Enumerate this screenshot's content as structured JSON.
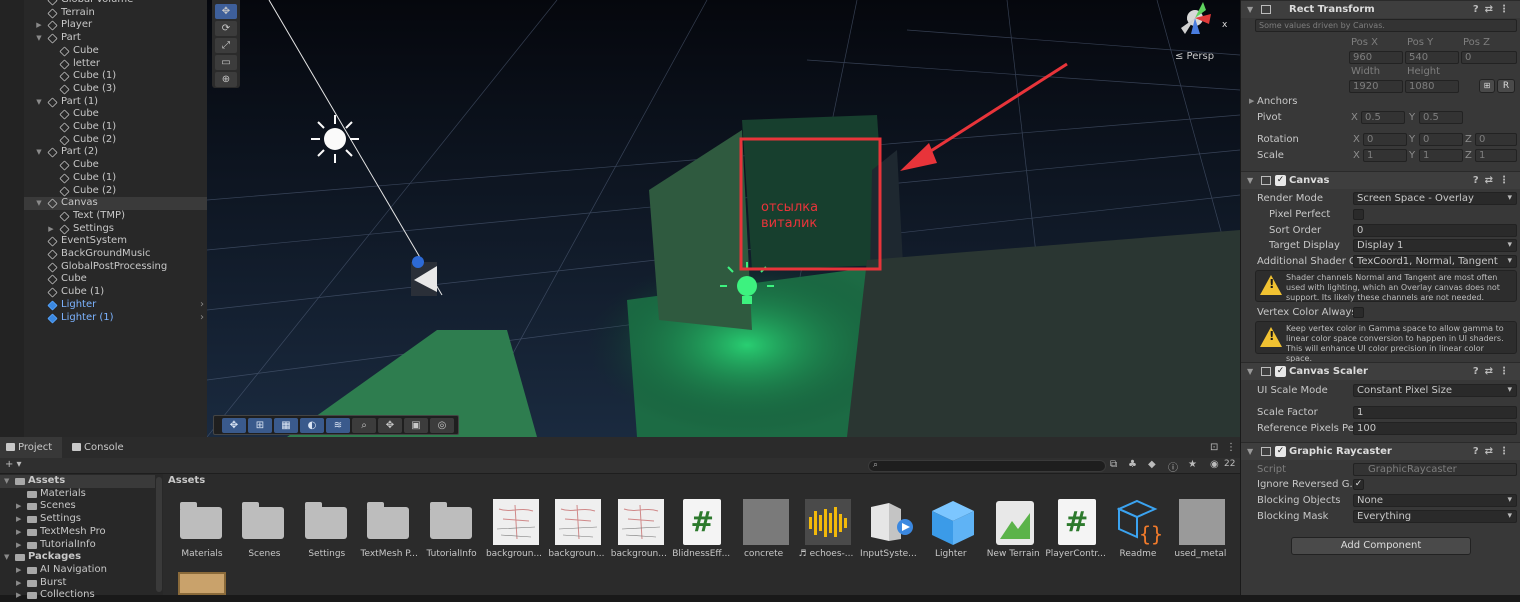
{
  "hierarchy": {
    "items": [
      {
        "label": "Global Volume",
        "indent": 2,
        "arrow": ""
      },
      {
        "label": "Terrain",
        "indent": 2,
        "arrow": ""
      },
      {
        "label": "Player",
        "indent": 2,
        "arrow": "▶"
      },
      {
        "label": "Part",
        "indent": 2,
        "arrow": "▼"
      },
      {
        "label": "Cube",
        "indent": 3,
        "arrow": ""
      },
      {
        "label": "letter",
        "indent": 3,
        "arrow": ""
      },
      {
        "label": "Cube (1)",
        "indent": 3,
        "arrow": ""
      },
      {
        "label": "Cube (3)",
        "indent": 3,
        "arrow": ""
      },
      {
        "label": "Part (1)",
        "indent": 2,
        "arrow": "▼"
      },
      {
        "label": "Cube",
        "indent": 3,
        "arrow": ""
      },
      {
        "label": "Cube (1)",
        "indent": 3,
        "arrow": ""
      },
      {
        "label": "Cube (2)",
        "indent": 3,
        "arrow": ""
      },
      {
        "label": "Part (2)",
        "indent": 2,
        "arrow": "▼"
      },
      {
        "label": "Cube",
        "indent": 3,
        "arrow": ""
      },
      {
        "label": "Cube (1)",
        "indent": 3,
        "arrow": ""
      },
      {
        "label": "Cube (2)",
        "indent": 3,
        "arrow": ""
      },
      {
        "label": "Canvas",
        "indent": 2,
        "arrow": "▼",
        "selected": true
      },
      {
        "label": "Text (TMP)",
        "indent": 3,
        "arrow": ""
      },
      {
        "label": "Settings",
        "indent": 3,
        "arrow": "▶"
      },
      {
        "label": "EventSystem",
        "indent": 2,
        "arrow": ""
      },
      {
        "label": "BackGroundMusic",
        "indent": 2,
        "arrow": ""
      },
      {
        "label": "GlobalPostProcessing",
        "indent": 2,
        "arrow": ""
      },
      {
        "label": "Cube",
        "indent": 2,
        "arrow": ""
      },
      {
        "label": "Cube (1)",
        "indent": 2,
        "arrow": ""
      },
      {
        "label": "Lighter",
        "indent": 2,
        "arrow": "",
        "prefab": true
      },
      {
        "label": "Lighter (1)",
        "indent": 2,
        "arrow": "",
        "prefab": true
      }
    ]
  },
  "scene": {
    "persp_label": "≤ Persp",
    "gizmo_axis": "x",
    "annotation_text": "отсылка\nвиталик",
    "tools": [
      "✥",
      "⟳",
      "⤢",
      "▭",
      "⊕"
    ]
  },
  "inspector": {
    "rect_transform": {
      "title": "Rect Transform",
      "note": "Some values driven by Canvas.",
      "pos_labels": [
        "Pos X",
        "Pos Y",
        "Pos Z"
      ],
      "pos_values": [
        "960",
        "540",
        "0"
      ],
      "size_labels": [
        "Width",
        "Height"
      ],
      "size_values": [
        "1920",
        "1080"
      ],
      "r_button": "R",
      "anchors": "Anchors",
      "pivot": "Pivot",
      "pivot_x": "0.5",
      "pivot_y": "0.5",
      "rotation": "Rotation",
      "rotation_values": [
        "0",
        "0",
        "0"
      ],
      "scale": "Scale",
      "scale_values": [
        "1",
        "1",
        "1"
      ],
      "axis_x": "X",
      "axis_y": "Y",
      "axis_z": "Z"
    },
    "canvas": {
      "title": "Canvas",
      "render_mode_label": "Render Mode",
      "render_mode": "Screen Space - Overlay",
      "pixel_perfect_label": "Pixel Perfect",
      "sort_order_label": "Sort Order",
      "sort_order": "0",
      "target_display_label": "Target Display",
      "target_display": "Display 1",
      "shader_channels_label": "Additional Shader Ch",
      "shader_channels": "TexCoord1, Normal, Tangent",
      "help1": "Shader channels Normal and Tangent are most often used with lighting, which an Overlay canvas does not support. Its likely these channels are not needed.",
      "vertex_color_label": "Vertex Color Always I",
      "help2": "Keep vertex color in Gamma space to allow gamma to linear color space conversion to happen in UI shaders. This will enhance UI color precision in linear color space."
    },
    "canvas_scaler": {
      "title": "Canvas Scaler",
      "ui_scale_mode_label": "UI Scale Mode",
      "ui_scale_mode": "Constant Pixel Size",
      "scale_factor_label": "Scale Factor",
      "scale_factor": "1",
      "ref_ppu_label": "Reference Pixels Per",
      "ref_ppu": "100"
    },
    "graphic_raycaster": {
      "title": "Graphic Raycaster",
      "script_label": "Script",
      "script": "GraphicRaycaster",
      "ignore_reversed_label": "Ignore Reversed G...",
      "blocking_objects_label": "Blocking Objects",
      "blocking_objects": "None",
      "blocking_mask_label": "Blocking Mask",
      "blocking_mask": "Everything"
    },
    "add_component": "Add Component"
  },
  "project": {
    "tab_project": "Project",
    "tab_console": "Console",
    "add": "+ ▾",
    "count": "22",
    "breadcrumb": "Assets",
    "tree": [
      {
        "label": "Assets",
        "level": 0,
        "arrow": "▼",
        "bold": true,
        "selected": true
      },
      {
        "label": "Materials",
        "level": 1,
        "arrow": ""
      },
      {
        "label": "Scenes",
        "level": 1,
        "arrow": "▶"
      },
      {
        "label": "Settings",
        "level": 1,
        "arrow": "▶"
      },
      {
        "label": "TextMesh Pro",
        "level": 1,
        "arrow": "▶"
      },
      {
        "label": "TutorialInfo",
        "level": 1,
        "arrow": "▶"
      },
      {
        "label": "Packages",
        "level": 0,
        "arrow": "▼",
        "bold": true
      },
      {
        "label": "AI Navigation",
        "level": 1,
        "arrow": "▶"
      },
      {
        "label": "Burst",
        "level": 1,
        "arrow": "▶"
      },
      {
        "label": "Collections",
        "level": 1,
        "arrow": "▶"
      }
    ],
    "assets": [
      {
        "name": "Materials",
        "kind": "folder"
      },
      {
        "name": "Scenes",
        "kind": "folder"
      },
      {
        "name": "Settings",
        "kind": "folder"
      },
      {
        "name": "TextMesh P...",
        "kind": "folder"
      },
      {
        "name": "TutorialInfo",
        "kind": "folder"
      },
      {
        "name": "backgroun...",
        "kind": "paper"
      },
      {
        "name": "backgroun...",
        "kind": "paper"
      },
      {
        "name": "backgroun...",
        "kind": "paper"
      },
      {
        "name": "BlidnessEff...",
        "kind": "script"
      },
      {
        "name": "concrete",
        "kind": "concrete"
      },
      {
        "name": "♬ echoes-...",
        "kind": "audio"
      },
      {
        "name": "InputSyste...",
        "kind": "input"
      },
      {
        "name": "Lighter",
        "kind": "prefab"
      },
      {
        "name": "New Terrain",
        "kind": "terrain"
      },
      {
        "name": "PlayerContr...",
        "kind": "script"
      },
      {
        "name": "Readme",
        "kind": "readme"
      },
      {
        "name": "used_metal",
        "kind": "metal"
      }
    ]
  },
  "colors": {
    "accent": "#3e5f9a",
    "annotation": "#e8343a",
    "prefab": "#7cb3ff",
    "warning": "#f1c232"
  }
}
